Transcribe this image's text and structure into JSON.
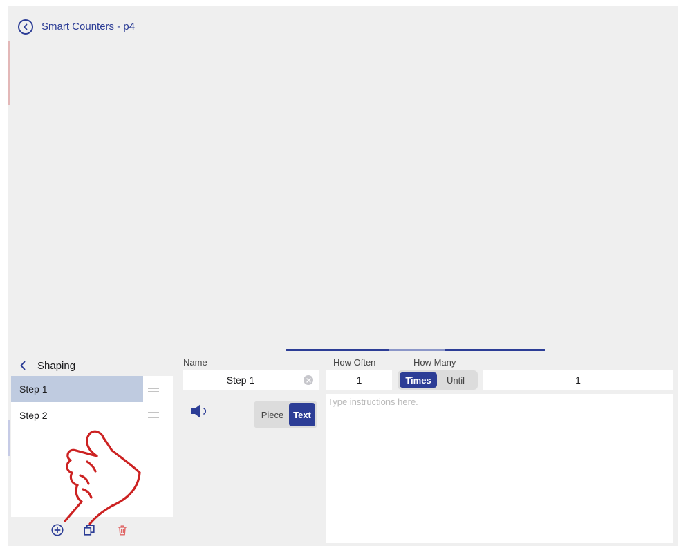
{
  "header": {
    "title": "Smart Counters - p4"
  },
  "step_panel": {
    "title": "Shaping",
    "steps": [
      {
        "label": "Step 1",
        "selected": true
      },
      {
        "label": "Step 2",
        "selected": false
      }
    ],
    "toolbar": {
      "add_icon": "plus-circle-icon",
      "duplicate_icon": "duplicate-icon",
      "delete_icon": "trash-icon"
    }
  },
  "form": {
    "name_label": "Name",
    "name_value": "Step 1",
    "how_often_label": "How Often",
    "how_often_value": "1",
    "how_many_label": "How Many",
    "times_label": "Times",
    "until_label": "Until",
    "how_many_value": "1",
    "piece_label": "Piece",
    "text_label": "Text",
    "instructions_placeholder": "Type instructions here."
  },
  "colors": {
    "accent": "#2c3d96",
    "selected_row": "#bfcbe0",
    "delete": "#e06666",
    "hand_outline": "#cc2222"
  }
}
